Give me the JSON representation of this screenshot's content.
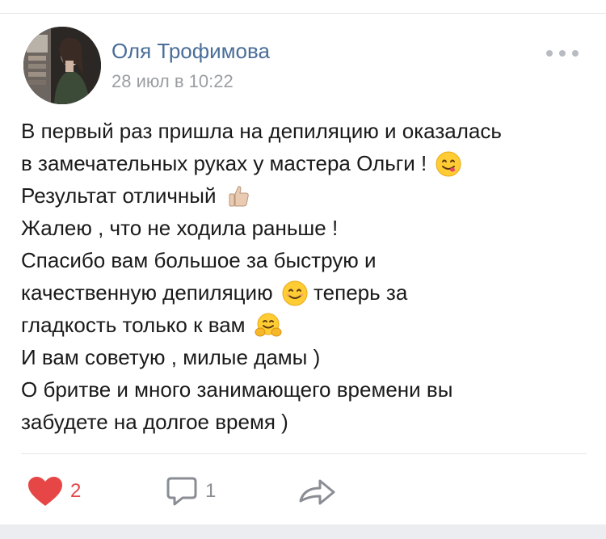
{
  "post": {
    "author": "Оля Трофимова",
    "timestamp": "28 июл в 10:22",
    "lines": [
      "В первый раз пришла на депиляцию и оказалась",
      "в замечательных руках у мастера Ольги !",
      "Результат отличный",
      "Жалею , что не ходила раньше !",
      "Спасибо вам большое за быструю и",
      "качественную депиляцию",
      "гладкость только к вам",
      "И вам советую , милые дамы )",
      "О бритве и много занимающего времени вы",
      "забудете на долгое время )"
    ],
    "line6_tail": "теперь за",
    "emoji": {
      "line2": "face-savoring-food-icon",
      "line3": "thumbs-up-icon",
      "line6": "smiling-face-icon",
      "line7": "hugging-face-icon"
    }
  },
  "actions": {
    "likes": "2",
    "comments": "1"
  },
  "colors": {
    "author": "#4a6e98",
    "timestamp": "#9a9da2",
    "like": "#e64646",
    "muted": "#8a8e94",
    "divider": "#e4e6ea"
  }
}
